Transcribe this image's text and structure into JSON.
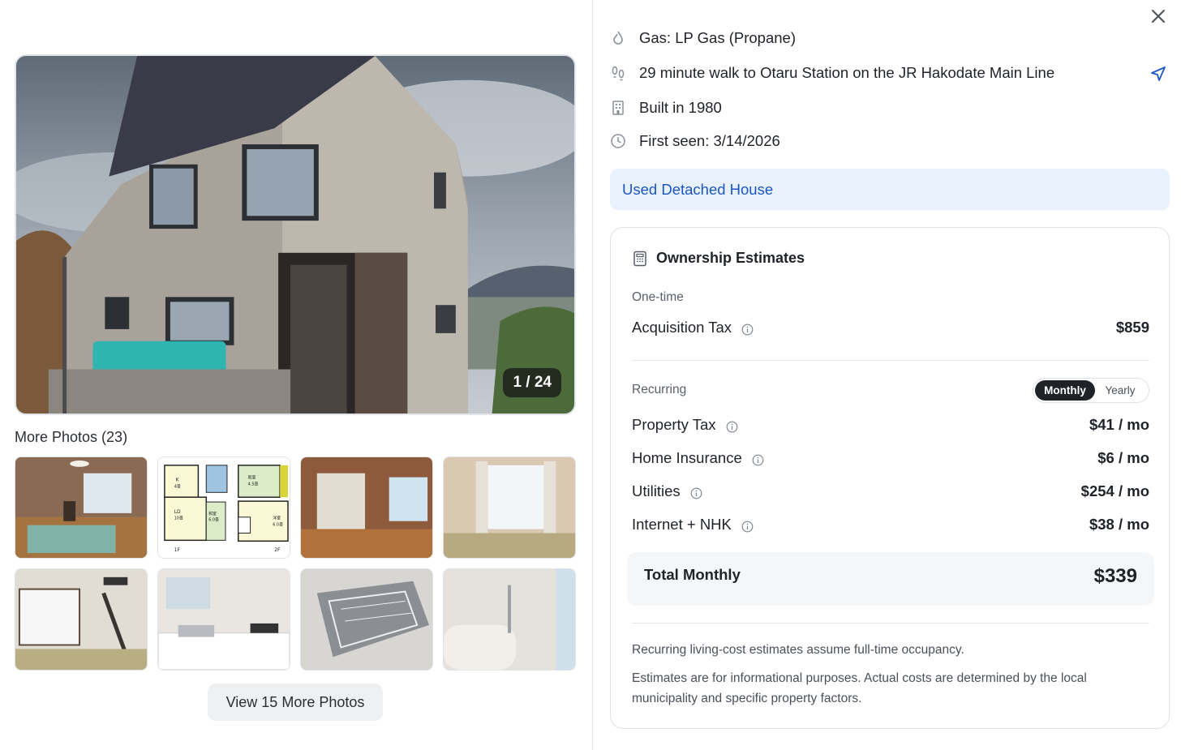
{
  "gallery": {
    "counter": "1 / 24",
    "more_photos_title": "More Photos (23)",
    "view_more_label": "View 15 More Photos",
    "thumbnails": [
      "living-room",
      "floor-plan",
      "bedroom",
      "window-room",
      "tatami-room",
      "kitchen",
      "dishwasher",
      "bathroom"
    ]
  },
  "floorplan": {
    "k": "K",
    "k_size": "4畳",
    "ld": "LD",
    "ld_size": "10畳",
    "wa": "和室",
    "wa_size": "6.0畳",
    "f1": "1F",
    "wa2": "和室",
    "wa2_size": "4.5畳",
    "you": "洋室",
    "you_size": "6.0畳",
    "f2": "2F"
  },
  "details": {
    "gas": "Gas: LP Gas (Propane)",
    "walk": "29 minute walk to Otaru Station on the JR Hakodate Main Line",
    "built": "Built in 1980",
    "first_seen": "First seen: 3/14/2026"
  },
  "property_type": "Used Detached House",
  "estimates": {
    "title": "Ownership Estimates",
    "one_time_label": "One-time",
    "acquisition_tax": {
      "label": "Acquisition Tax",
      "value": "$859"
    },
    "recurring_label": "Recurring",
    "toggle": {
      "monthly": "Monthly",
      "yearly": "Yearly",
      "selected": "Monthly"
    },
    "property_tax": {
      "label": "Property Tax",
      "value": "$41 / mo"
    },
    "home_insurance": {
      "label": "Home Insurance",
      "value": "$6 / mo"
    },
    "utilities": {
      "label": "Utilities",
      "value": "$254 / mo"
    },
    "internet": {
      "label": "Internet + NHK",
      "value": "$38 / mo"
    },
    "total": {
      "label": "Total Monthly",
      "value": "$339"
    },
    "note_occupancy": "Recurring living-cost estimates assume full-time occupancy.",
    "note_disclaimer": "Estimates are for informational purposes. Actual costs are determined by the local municipality and specific property factors."
  },
  "colors": {
    "accent": "#1a56c4",
    "badge_bg": "#e9f1fc"
  }
}
